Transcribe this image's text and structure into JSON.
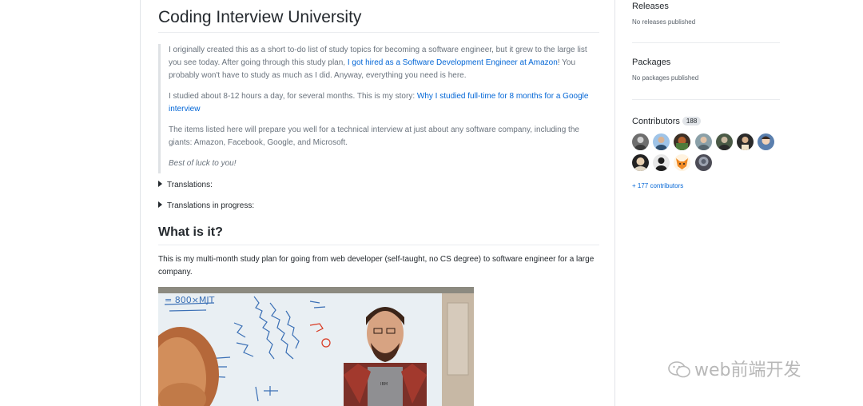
{
  "readme": {
    "title": "Coding Interview University",
    "intro": {
      "p1_a": "I originally created this as a short to-do list of study topics for becoming a software engineer, but it grew to the large list you see today. After going through this study plan, ",
      "p1_link": "I got hired as a Software Development Engineer at Amazon",
      "p1_b": "! You probably won't have to study as much as I did. Anyway, everything you need is here.",
      "p2_a": "I studied about 8-12 hours a day, for several months. This is my story: ",
      "p2_link": "Why I studied full-time for 8 months for a Google interview",
      "p3": "The items listed here will prepare you well for a technical interview at just about any software company, including the giants: Amazon, Facebook, Google, and Microsoft.",
      "p4": "Best of luck to you!"
    },
    "details": [
      {
        "label": "Translations:"
      },
      {
        "label": "Translations in progress:"
      }
    ],
    "section_heading": "What is it?",
    "section_text": "This is my multi-month study plan for going from web developer (self-taught, no CS degree) to software engineer for a large company.",
    "image_words": [
      "= 800×MJT",
      "IBM"
    ]
  },
  "sidebar": {
    "releases": {
      "title": "Releases",
      "note": "No releases published"
    },
    "packages": {
      "title": "Packages",
      "note": "No packages published"
    },
    "contributors": {
      "title": "Contributors",
      "count": "188",
      "more": "+ 177 contributors"
    }
  },
  "watermark": "web前端开发"
}
